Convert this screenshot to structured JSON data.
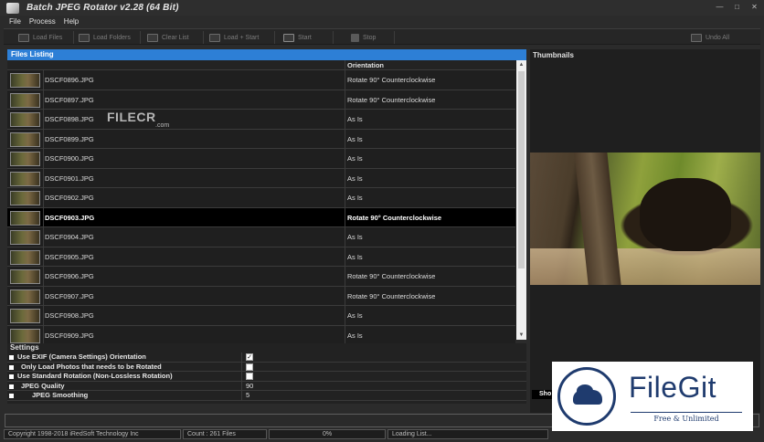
{
  "window": {
    "title": "Batch JPEG Rotator v2.28 (64 Bit)"
  },
  "menu": [
    "File",
    "Process",
    "Help"
  ],
  "toolbar": {
    "load_files": "Load Files",
    "load_folders": "Load Folders",
    "clear_list": "Clear List",
    "load_start": "Load + Start",
    "start": "Start",
    "stop": "Stop",
    "undo_all": "Undo All"
  },
  "files_panel": {
    "title": "Files Listing",
    "col_orientation": "Orientation",
    "rows": [
      {
        "name": "DSCF0896.JPG",
        "orientation": "Rotate 90° Counterclockwise",
        "selected": false
      },
      {
        "name": "DSCF0897.JPG",
        "orientation": "Rotate 90° Counterclockwise",
        "selected": false
      },
      {
        "name": "DSCF0898.JPG",
        "orientation": "As Is",
        "selected": false
      },
      {
        "name": "DSCF0899.JPG",
        "orientation": "As Is",
        "selected": false
      },
      {
        "name": "DSCF0900.JPG",
        "orientation": "As Is",
        "selected": false
      },
      {
        "name": "DSCF0901.JPG",
        "orientation": "As Is",
        "selected": false
      },
      {
        "name": "DSCF0902.JPG",
        "orientation": "As Is",
        "selected": false
      },
      {
        "name": "DSCF0903.JPG",
        "orientation": "Rotate 90° Counterclockwise",
        "selected": true
      },
      {
        "name": "DSCF0904.JPG",
        "orientation": "As Is",
        "selected": false
      },
      {
        "name": "DSCF0905.JPG",
        "orientation": "As Is",
        "selected": false
      },
      {
        "name": "DSCF0906.JPG",
        "orientation": "Rotate 90° Counterclockwise",
        "selected": false
      },
      {
        "name": "DSCF0907.JPG",
        "orientation": "Rotate 90° Counterclockwise",
        "selected": false
      },
      {
        "name": "DSCF0908.JPG",
        "orientation": "As Is",
        "selected": false
      },
      {
        "name": "DSCF0909.JPG",
        "orientation": "As Is",
        "selected": false
      }
    ]
  },
  "watermark": {
    "text": "FILECR",
    "sub": ".com"
  },
  "thumbnails": {
    "title": "Thumbnails",
    "show_label": "Sho"
  },
  "settings": {
    "title": "Settings",
    "items": [
      {
        "label": "Use EXIF (Camera Settings) Orientation",
        "type": "checkbox",
        "checked": true,
        "indent": 0
      },
      {
        "label": "Only Load Photos that needs to be Rotated",
        "type": "checkbox",
        "checked": false,
        "indent": 1
      },
      {
        "label": "Use Standard Rotation (Non-Lossless Rotation)",
        "type": "checkbox",
        "checked": false,
        "indent": 0
      },
      {
        "label": "JPEG Quality",
        "type": "value",
        "value": "90",
        "indent": 1
      },
      {
        "label": "JPEG Smoothing",
        "type": "value",
        "value": "5",
        "indent": 2
      }
    ]
  },
  "progress": {
    "fraction": 0
  },
  "status": {
    "copyright": "Copyright 1998-2018 iRedSoft Technology Inc",
    "count": "Count : 261 Files",
    "percent": "0%",
    "loading": "Loading List..."
  },
  "filegit": {
    "name": "FileGit",
    "tagline": "Free & Unlimited"
  },
  "colors": {
    "accent": "#2d7fd6",
    "selected_row": "#000000",
    "brand": "#1f3b6e"
  }
}
